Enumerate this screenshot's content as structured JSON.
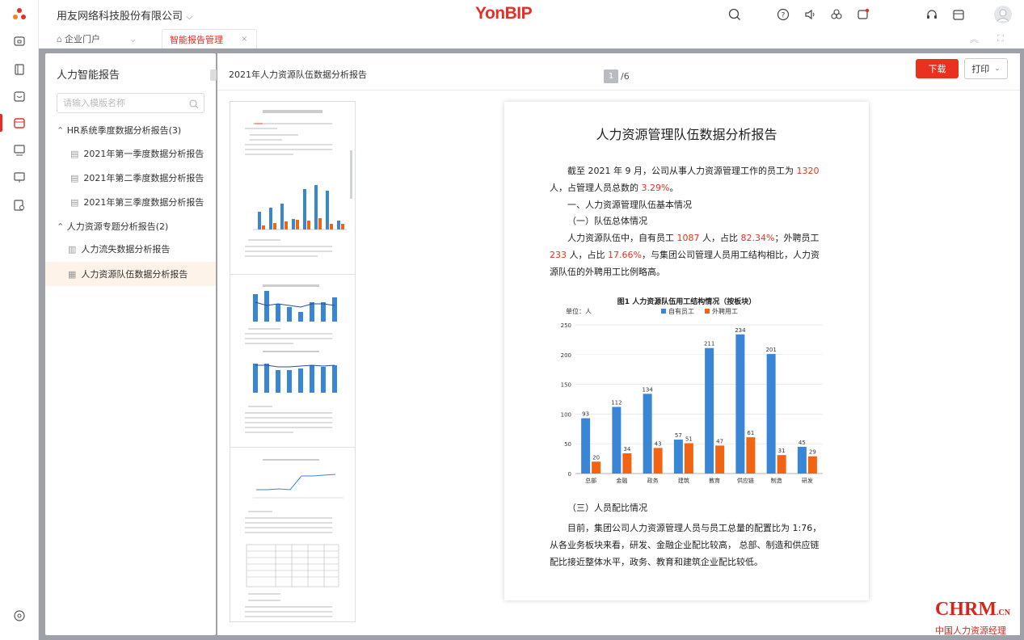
{
  "topbar": {
    "company": "用友网络科技股份有限公司",
    "logo": "YonBIP"
  },
  "tabs": {
    "portal": "企业门户",
    "active": "智能报告管理"
  },
  "panel": {
    "title": "人力智能报告",
    "search_placeholder": "请输入模版名称",
    "groups": [
      {
        "label": "HR系统季度数据分析报告(3)",
        "items": [
          "2021年第一季度数据分析报告",
          "2021年第二季度数据分析报告",
          "2021年第三季度数据分析报告"
        ]
      },
      {
        "label": "人力资源专题分析报告(2)",
        "items": [
          "人力流失数据分析报告",
          "人力资源队伍数据分析报告"
        ]
      }
    ]
  },
  "viewer": {
    "title": "2021年人力资源队伍数据分析报告",
    "page_current": "1",
    "page_total": "/6",
    "download": "下载",
    "print": "打印"
  },
  "document": {
    "heading": "人力资源管理队伍数据分析报告",
    "p1": [
      "截至 2021 年 9 月，公司从事人力资源管理工作的员工为 ",
      "1320",
      " 人，占管理人员总数的 ",
      "3.29%",
      "。"
    ],
    "s1": "一、人力资源管理队伍基本情况",
    "s2": "（一）队伍总体情况",
    "p2": [
      "人力资源队伍中，自有员工 ",
      "1087",
      " 人，占比 ",
      "82.34%",
      "；外聘员工 ",
      "233",
      " 人，占比 ",
      "17.66%",
      "，与集团公司管理人员用工结构相比，人力资源队伍的外聘用工比例略高。"
    ],
    "s3": "（三）人员配比情况",
    "p3": "目前，集团公司人力资源管理人员与员工总量的配置比为 1:76，从各业务板块来看，研发、金融企业配比较高， 总部、制造和供应链配比接近整体水平，政务、教育和建筑企业配比较低。"
  },
  "chart_data": {
    "type": "bar",
    "title": "图1 人力资源队伍用工结构情况（按板块）",
    "unit_label": "单位：人",
    "categories": [
      "总部",
      "金融",
      "政务",
      "建筑",
      "教育",
      "供应链",
      "制造",
      "研发"
    ],
    "series": [
      {
        "name": "自有员工",
        "values": [
          93,
          112,
          134,
          57,
          211,
          234,
          201,
          45
        ],
        "color": "#3a86d6"
      },
      {
        "name": "外聘用工",
        "values": [
          20,
          34,
          43,
          51,
          47,
          61,
          31,
          29
        ],
        "color": "#f06414"
      }
    ],
    "ylim": [
      0,
      250
    ],
    "yticks": [
      0,
      50,
      100,
      150,
      200,
      250
    ],
    "grid": true,
    "legend": "top"
  },
  "watermark": {
    "main": "CHRM",
    "suffix": ".CN",
    "sub": "中国人力资源经理"
  }
}
